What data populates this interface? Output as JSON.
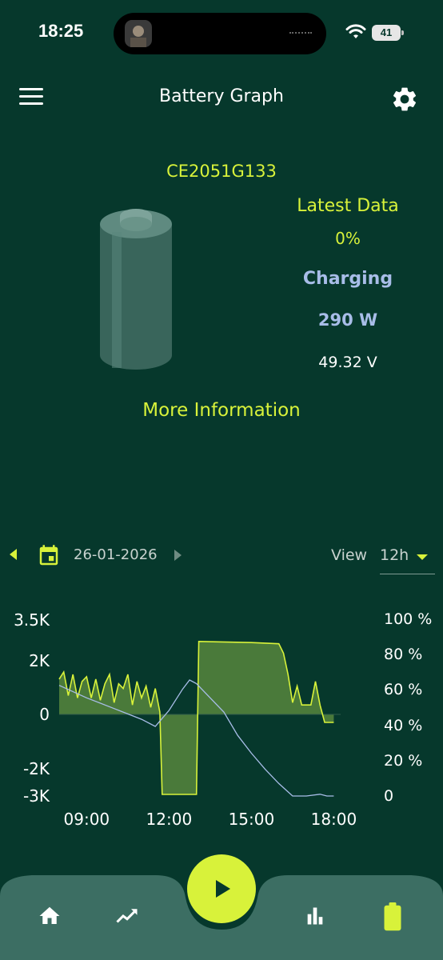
{
  "status_bar": {
    "time": "18:25",
    "battery": "41"
  },
  "header": {
    "title": "Battery Graph"
  },
  "battery": {
    "device_id": "CE2051G133",
    "latest_label": "Latest Data",
    "percent": "0%",
    "state": "Charging",
    "power": "290 W",
    "voltage": "49.32 V",
    "more_info": "More Information"
  },
  "date_nav": {
    "date": "26-01-2026",
    "view_label": "View",
    "view_value": "12h"
  },
  "colors": {
    "background": "#06382c",
    "accent": "#d8f23a",
    "secondary": "#a8bde8",
    "fill": "#4a7a3a",
    "nav": "#3c6e63"
  },
  "chart_data": {
    "type": "area",
    "left_axis": {
      "ticks": [
        "3.5K",
        "2K",
        "0",
        "-2K",
        "-3K"
      ]
    },
    "right_axis": {
      "ticks": [
        "100 %",
        "80 %",
        "60 %",
        "40 %",
        "20 %",
        "0"
      ]
    },
    "x_ticks": [
      "09:00",
      "12:00",
      "15:00",
      "18:00"
    ],
    "series": [
      {
        "color": "#d8f23a",
        "points": [
          [
            "08:00",
            1500
          ],
          [
            "08:10",
            1800
          ],
          [
            "08:20",
            800
          ],
          [
            "08:30",
            1700
          ],
          [
            "08:40",
            700
          ],
          [
            "08:50",
            1400
          ],
          [
            "09:00",
            1600
          ],
          [
            "09:10",
            700
          ],
          [
            "09:20",
            1500
          ],
          [
            "09:30",
            600
          ],
          [
            "09:40",
            1300
          ],
          [
            "09:50",
            1700
          ],
          [
            "10:00",
            500
          ],
          [
            "10:10",
            1300
          ],
          [
            "10:20",
            1100
          ],
          [
            "10:30",
            1700
          ],
          [
            "10:40",
            400
          ],
          [
            "10:50",
            1400
          ],
          [
            "11:00",
            700
          ],
          [
            "11:10",
            1200
          ],
          [
            "11:20",
            300
          ],
          [
            "11:30",
            1100
          ],
          [
            "11:40",
            100
          ],
          [
            "11:45",
            -3000
          ],
          [
            "12:30",
            -3000
          ],
          [
            "13:00",
            -3000
          ],
          [
            "13:05",
            3100
          ],
          [
            "15:00",
            3050
          ],
          [
            "16:00",
            3000
          ],
          [
            "16:10",
            2600
          ],
          [
            "16:20",
            1700
          ],
          [
            "16:30",
            500
          ],
          [
            "16:40",
            1200
          ],
          [
            "16:50",
            400
          ],
          [
            "17:00",
            400
          ],
          [
            "17:10",
            400
          ],
          [
            "17:20",
            1400
          ],
          [
            "17:30",
            400
          ],
          [
            "17:40",
            -300
          ],
          [
            "18:00",
            -300
          ]
        ]
      },
      {
        "color": "#a8bde8",
        "points": [
          [
            "08:00",
            62
          ],
          [
            "09:00",
            55
          ],
          [
            "10:00",
            49
          ],
          [
            "11:00",
            43
          ],
          [
            "11:30",
            39
          ],
          [
            "12:00",
            48
          ],
          [
            "12:30",
            60
          ],
          [
            "12:45",
            65
          ],
          [
            "13:00",
            63
          ],
          [
            "14:00",
            47
          ],
          [
            "14:30",
            34
          ],
          [
            "15:00",
            24
          ],
          [
            "15:30",
            15
          ],
          [
            "16:00",
            7
          ],
          [
            "16:30",
            0
          ],
          [
            "17:00",
            0
          ],
          [
            "17:30",
            1
          ],
          [
            "17:45",
            0
          ],
          [
            "18:00",
            0
          ]
        ]
      }
    ]
  }
}
